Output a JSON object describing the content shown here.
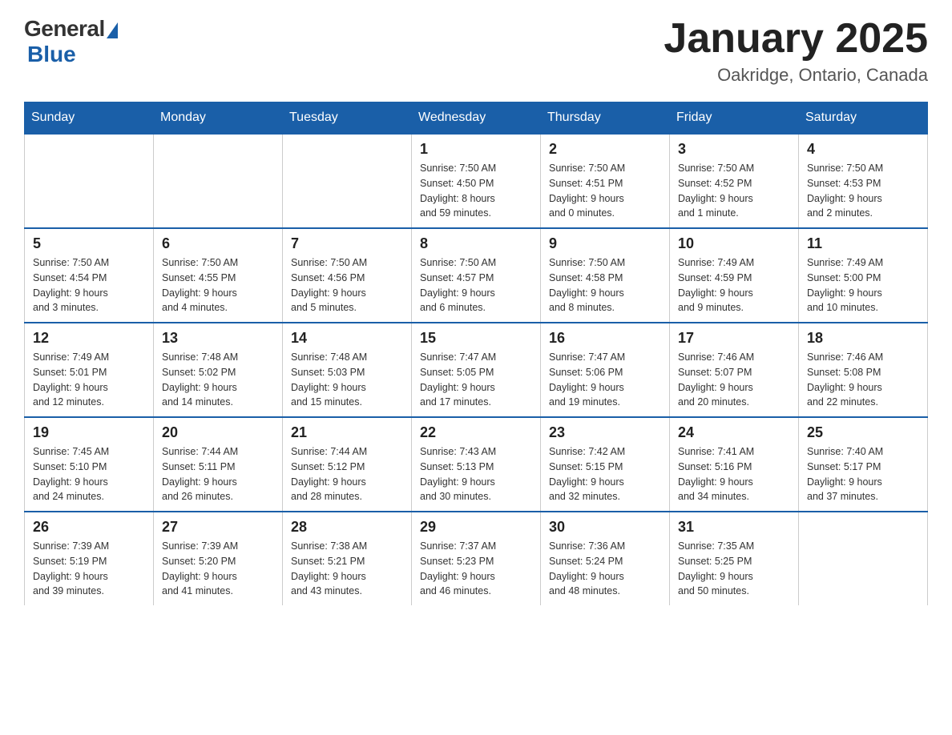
{
  "header": {
    "logo_general": "General",
    "logo_blue": "Blue",
    "month_title": "January 2025",
    "location": "Oakridge, Ontario, Canada"
  },
  "days_of_week": [
    "Sunday",
    "Monday",
    "Tuesday",
    "Wednesday",
    "Thursday",
    "Friday",
    "Saturday"
  ],
  "weeks": [
    [
      {
        "day": "",
        "info": ""
      },
      {
        "day": "",
        "info": ""
      },
      {
        "day": "",
        "info": ""
      },
      {
        "day": "1",
        "info": "Sunrise: 7:50 AM\nSunset: 4:50 PM\nDaylight: 8 hours\nand 59 minutes."
      },
      {
        "day": "2",
        "info": "Sunrise: 7:50 AM\nSunset: 4:51 PM\nDaylight: 9 hours\nand 0 minutes."
      },
      {
        "day": "3",
        "info": "Sunrise: 7:50 AM\nSunset: 4:52 PM\nDaylight: 9 hours\nand 1 minute."
      },
      {
        "day": "4",
        "info": "Sunrise: 7:50 AM\nSunset: 4:53 PM\nDaylight: 9 hours\nand 2 minutes."
      }
    ],
    [
      {
        "day": "5",
        "info": "Sunrise: 7:50 AM\nSunset: 4:54 PM\nDaylight: 9 hours\nand 3 minutes."
      },
      {
        "day": "6",
        "info": "Sunrise: 7:50 AM\nSunset: 4:55 PM\nDaylight: 9 hours\nand 4 minutes."
      },
      {
        "day": "7",
        "info": "Sunrise: 7:50 AM\nSunset: 4:56 PM\nDaylight: 9 hours\nand 5 minutes."
      },
      {
        "day": "8",
        "info": "Sunrise: 7:50 AM\nSunset: 4:57 PM\nDaylight: 9 hours\nand 6 minutes."
      },
      {
        "day": "9",
        "info": "Sunrise: 7:50 AM\nSunset: 4:58 PM\nDaylight: 9 hours\nand 8 minutes."
      },
      {
        "day": "10",
        "info": "Sunrise: 7:49 AM\nSunset: 4:59 PM\nDaylight: 9 hours\nand 9 minutes."
      },
      {
        "day": "11",
        "info": "Sunrise: 7:49 AM\nSunset: 5:00 PM\nDaylight: 9 hours\nand 10 minutes."
      }
    ],
    [
      {
        "day": "12",
        "info": "Sunrise: 7:49 AM\nSunset: 5:01 PM\nDaylight: 9 hours\nand 12 minutes."
      },
      {
        "day": "13",
        "info": "Sunrise: 7:48 AM\nSunset: 5:02 PM\nDaylight: 9 hours\nand 14 minutes."
      },
      {
        "day": "14",
        "info": "Sunrise: 7:48 AM\nSunset: 5:03 PM\nDaylight: 9 hours\nand 15 minutes."
      },
      {
        "day": "15",
        "info": "Sunrise: 7:47 AM\nSunset: 5:05 PM\nDaylight: 9 hours\nand 17 minutes."
      },
      {
        "day": "16",
        "info": "Sunrise: 7:47 AM\nSunset: 5:06 PM\nDaylight: 9 hours\nand 19 minutes."
      },
      {
        "day": "17",
        "info": "Sunrise: 7:46 AM\nSunset: 5:07 PM\nDaylight: 9 hours\nand 20 minutes."
      },
      {
        "day": "18",
        "info": "Sunrise: 7:46 AM\nSunset: 5:08 PM\nDaylight: 9 hours\nand 22 minutes."
      }
    ],
    [
      {
        "day": "19",
        "info": "Sunrise: 7:45 AM\nSunset: 5:10 PM\nDaylight: 9 hours\nand 24 minutes."
      },
      {
        "day": "20",
        "info": "Sunrise: 7:44 AM\nSunset: 5:11 PM\nDaylight: 9 hours\nand 26 minutes."
      },
      {
        "day": "21",
        "info": "Sunrise: 7:44 AM\nSunset: 5:12 PM\nDaylight: 9 hours\nand 28 minutes."
      },
      {
        "day": "22",
        "info": "Sunrise: 7:43 AM\nSunset: 5:13 PM\nDaylight: 9 hours\nand 30 minutes."
      },
      {
        "day": "23",
        "info": "Sunrise: 7:42 AM\nSunset: 5:15 PM\nDaylight: 9 hours\nand 32 minutes."
      },
      {
        "day": "24",
        "info": "Sunrise: 7:41 AM\nSunset: 5:16 PM\nDaylight: 9 hours\nand 34 minutes."
      },
      {
        "day": "25",
        "info": "Sunrise: 7:40 AM\nSunset: 5:17 PM\nDaylight: 9 hours\nand 37 minutes."
      }
    ],
    [
      {
        "day": "26",
        "info": "Sunrise: 7:39 AM\nSunset: 5:19 PM\nDaylight: 9 hours\nand 39 minutes."
      },
      {
        "day": "27",
        "info": "Sunrise: 7:39 AM\nSunset: 5:20 PM\nDaylight: 9 hours\nand 41 minutes."
      },
      {
        "day": "28",
        "info": "Sunrise: 7:38 AM\nSunset: 5:21 PM\nDaylight: 9 hours\nand 43 minutes."
      },
      {
        "day": "29",
        "info": "Sunrise: 7:37 AM\nSunset: 5:23 PM\nDaylight: 9 hours\nand 46 minutes."
      },
      {
        "day": "30",
        "info": "Sunrise: 7:36 AM\nSunset: 5:24 PM\nDaylight: 9 hours\nand 48 minutes."
      },
      {
        "day": "31",
        "info": "Sunrise: 7:35 AM\nSunset: 5:25 PM\nDaylight: 9 hours\nand 50 minutes."
      },
      {
        "day": "",
        "info": ""
      }
    ]
  ]
}
